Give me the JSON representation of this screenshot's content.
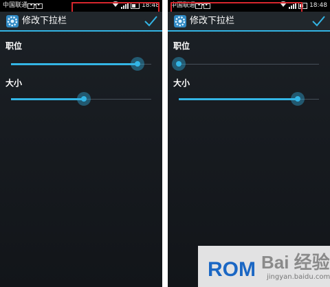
{
  "status_bar": {
    "carrier": "中国联通 •••",
    "time": "18:48"
  },
  "action_bar": {
    "title": "修改下拉栏"
  },
  "screens": [
    {
      "position_label": "职位",
      "position_value": 0.9,
      "size_label": "大小",
      "size_value": 0.52
    },
    {
      "position_label": "职位",
      "position_value": 0.0,
      "size_label": "大小",
      "size_value": 0.85
    }
  ],
  "watermark": {
    "rom": "ROM",
    "baidu": "Bai 经验",
    "url": "jingyan.baidu.com"
  },
  "colors": {
    "accent": "#33b5e5",
    "highlight": "#d7262d"
  },
  "icons": {
    "app": "gear-icon",
    "done": "checkmark-icon"
  }
}
